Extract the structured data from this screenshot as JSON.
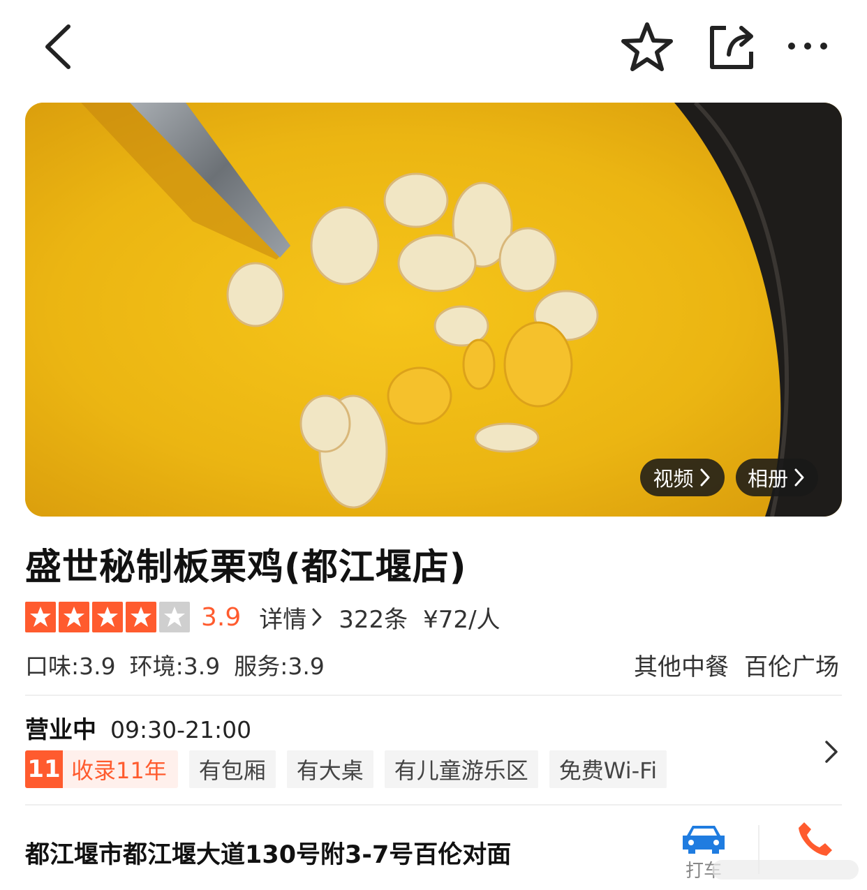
{
  "topbar": {
    "back_icon": "back-chevron-icon",
    "favorite_icon": "star-outline-icon",
    "share_icon": "share-icon",
    "more_icon": "more-dots-icon"
  },
  "hero": {
    "video_label": "视频",
    "album_label": "相册"
  },
  "shop": {
    "name": "盛世秘制板栗鸡(都江堰店)",
    "rating": 3.9,
    "rating_text": "3.9",
    "detail_label": "详情",
    "review_count": "322条",
    "price": "¥72/人",
    "subscores": [
      "口味:3.9",
      "环境:3.9",
      "服务:3.9"
    ],
    "category": "其他中餐",
    "area": "百伦广场",
    "status": "营业中",
    "hours": "09:30-21:00",
    "years_badge_num": "11",
    "years_badge_text": "收录11年",
    "features": [
      "有包厢",
      "有大桌",
      "有儿童游乐区",
      "免费Wi-Fi"
    ],
    "address": "都江堰市都江堰大道130号附3-7号百伦对面",
    "taxi_label": "打车"
  },
  "colors": {
    "accent": "#ff5b2e",
    "taxi_blue": "#1f7ce0",
    "star_empty": "#cfcfcf"
  }
}
